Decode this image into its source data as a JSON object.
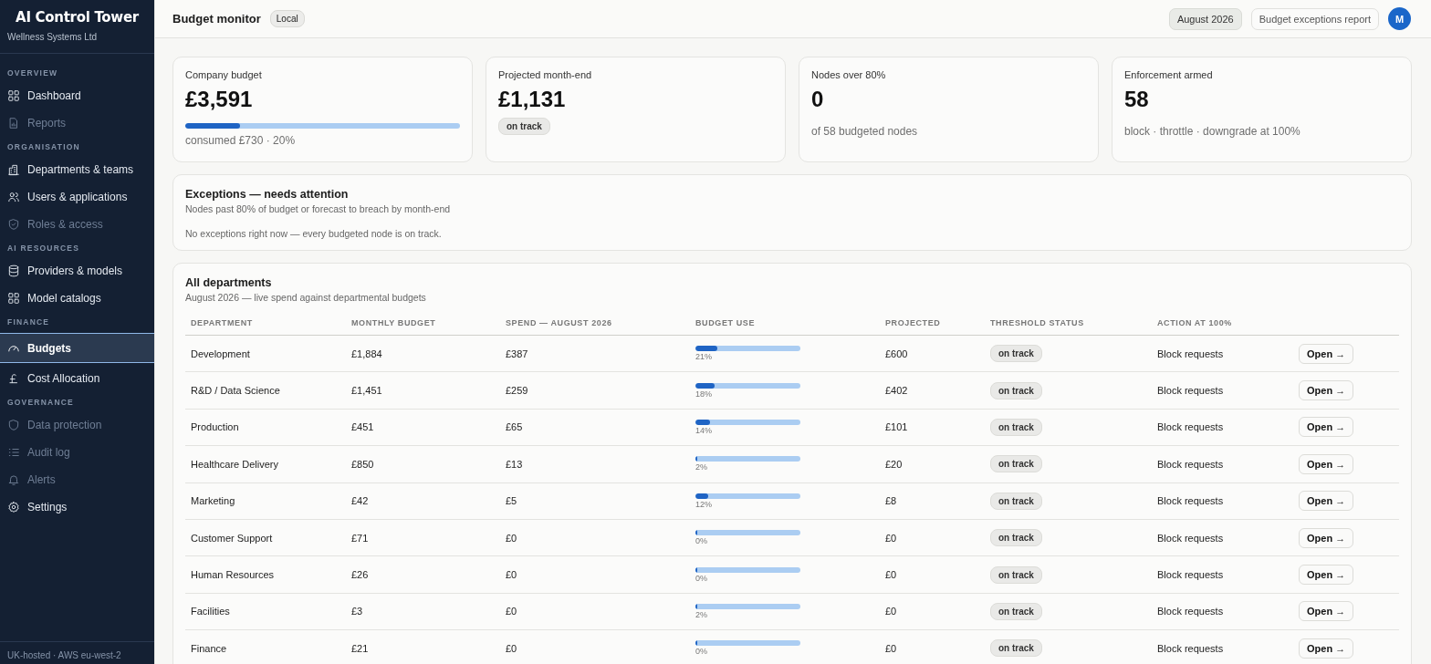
{
  "sidebar": {
    "title": "AI Control Tower",
    "subtitle": "Wellness Systems Ltd",
    "sections": [
      {
        "heading": "OVERVIEW",
        "items": [
          {
            "label": "Dashboard",
            "selected": false,
            "disabled": false
          },
          {
            "label": "Reports",
            "selected": false,
            "disabled": true
          }
        ]
      },
      {
        "heading": "ORGANISATION",
        "items": [
          {
            "label": "Departments & teams",
            "selected": false,
            "disabled": false
          },
          {
            "label": "Users & applications",
            "selected": false,
            "disabled": false
          },
          {
            "label": "Roles & access",
            "selected": false,
            "disabled": true
          }
        ]
      },
      {
        "heading": "AI RESOURCES",
        "items": [
          {
            "label": "Providers & models",
            "selected": false,
            "disabled": false
          },
          {
            "label": "Model catalogs",
            "selected": false,
            "disabled": false
          }
        ]
      },
      {
        "heading": "FINANCE",
        "items": [
          {
            "label": "Budgets",
            "selected": true,
            "disabled": false
          },
          {
            "label": "Cost Allocation",
            "selected": false,
            "disabled": false
          }
        ]
      },
      {
        "heading": "GOVERNANCE",
        "items": [
          {
            "label": "Data protection",
            "selected": false,
            "disabled": true
          },
          {
            "label": "Audit log",
            "selected": false,
            "disabled": true
          },
          {
            "label": "Alerts",
            "selected": false,
            "disabled": true
          },
          {
            "label": "Settings",
            "selected": false,
            "disabled": false
          }
        ]
      }
    ],
    "footer": "UK-hosted · AWS eu-west-2"
  },
  "header": {
    "title": "Budget monitor",
    "badge": "Local",
    "period": "August 2026",
    "report_button": "Budget exceptions report",
    "avatar": "M"
  },
  "stats": [
    {
      "label": "Company budget",
      "value": "£3,591",
      "level": 0.2,
      "note": "consumed £730 · 20%"
    },
    {
      "label": "Projected month-end",
      "value": "£1,131",
      "status": "on track"
    },
    {
      "label": "Nodes over 80%",
      "value": "0",
      "note": "of 58 budgeted nodes"
    },
    {
      "label": "Enforcement armed",
      "value": "58",
      "note": "block · throttle · downgrade at 100%"
    }
  ],
  "exceptions": {
    "title": "Exceptions — needs attention",
    "subtitle": "Nodes past 80% of budget or forecast to breach by month-end",
    "message": "No exceptions right now — every budgeted node is on track."
  },
  "departments": {
    "title": "All departments",
    "subtitle": "August 2026 — live spend against departmental budgets",
    "columns": [
      "DEPARTMENT",
      "MONTHLY BUDGET",
      "SPEND — AUGUST 2026",
      "BUDGET USE",
      "PROJECTED",
      "THRESHOLD STATUS",
      "ACTION AT 100%"
    ],
    "rows": [
      {
        "department": "Development",
        "budget": "£1,884",
        "spend": "£387",
        "level": 0.21,
        "use": "21%",
        "projected": "£600",
        "status": "on track",
        "action": "Block requests",
        "button": "Open →"
      },
      {
        "department": "R&D / Data Science",
        "budget": "£1,451",
        "spend": "£259",
        "level": 0.18,
        "use": "18%",
        "projected": "£402",
        "status": "on track",
        "action": "Block requests",
        "button": "Open →"
      },
      {
        "department": "Production",
        "budget": "£451",
        "spend": "£65",
        "level": 0.14,
        "use": "14%",
        "projected": "£101",
        "status": "on track",
        "action": "Block requests",
        "button": "Open →"
      },
      {
        "department": "Healthcare Delivery",
        "budget": "£850",
        "spend": "£13",
        "level": 0.02,
        "use": "2%",
        "projected": "£20",
        "status": "on track",
        "action": "Block requests",
        "button": "Open →"
      },
      {
        "department": "Marketing",
        "budget": "£42",
        "spend": "£5",
        "level": 0.12,
        "use": "12%",
        "projected": "£8",
        "status": "on track",
        "action": "Block requests",
        "button": "Open →"
      },
      {
        "department": "Customer Support",
        "budget": "£71",
        "spend": "£0",
        "level": 0.0,
        "use": "0%",
        "projected": "£0",
        "status": "on track",
        "action": "Block requests",
        "button": "Open →"
      },
      {
        "department": "Human Resources",
        "budget": "£26",
        "spend": "£0",
        "level": 0.0,
        "use": "0%",
        "projected": "£0",
        "status": "on track",
        "action": "Block requests",
        "button": "Open →"
      },
      {
        "department": "Facilities",
        "budget": "£3",
        "spend": "£0",
        "level": 0.02,
        "use": "2%",
        "projected": "£0",
        "status": "on track",
        "action": "Block requests",
        "button": "Open →"
      },
      {
        "department": "Finance",
        "budget": "£21",
        "spend": "£0",
        "level": 0.0,
        "use": "0%",
        "projected": "£0",
        "status": "on track",
        "action": "Block requests",
        "button": "Open →"
      }
    ]
  }
}
